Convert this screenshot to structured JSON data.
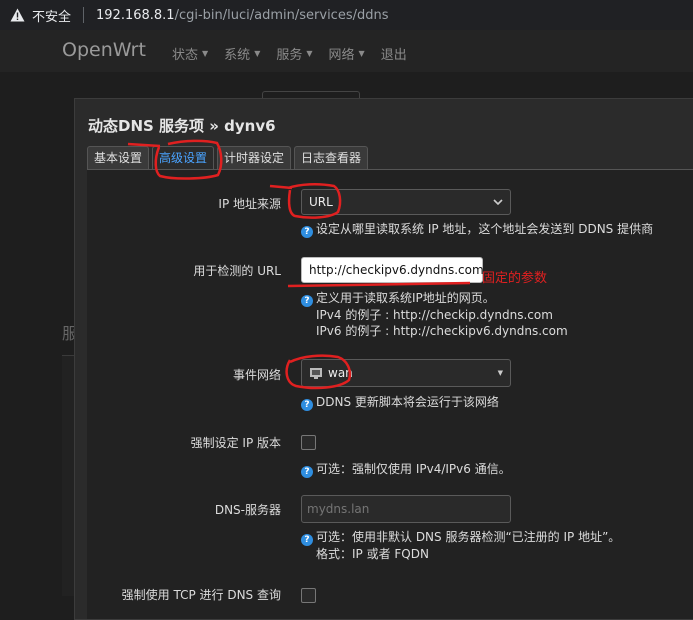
{
  "browser": {
    "insecure_label": "不安全",
    "url_host": "192.168.8.1",
    "url_path": "/cgi-bin/luci/admin/services/ddns"
  },
  "nav": {
    "brand": "OpenWrt",
    "items": [
      "状态",
      "系统",
      "服务",
      "网络",
      "退出"
    ]
  },
  "background": {
    "partial_heading": "服"
  },
  "modal": {
    "title": "动态DNS 服务项 » dynv6",
    "tabs": [
      "基本设置",
      "高级设置",
      "计时器设定",
      "日志查看器"
    ],
    "active_tab": "高级设置",
    "fields": {
      "ip_source": {
        "label": "IP 地址来源",
        "value": "URL",
        "help": "设定从哪里读取系统 IP 地址，这个地址会发送到 DDNS 提供商"
      },
      "check_url": {
        "label": "用于检测的 URL",
        "value": "http://checkipv6.dyndns.com",
        "help": "定义用于读取系统IP地址的网页。",
        "help_line2": "IPv4 的例子 : http://checkip.dyndns.com",
        "help_line3": "IPv6 的例子 : http://checkipv6.dyndns.com"
      },
      "event_network": {
        "label": "事件网络",
        "value": "wan",
        "help": "DDNS 更新脚本将会运行于该网络"
      },
      "force_ip_version": {
        "label": "强制设定 IP 版本",
        "help": "可选：强制仅使用 IPv4/IPv6 通信。"
      },
      "dns_server": {
        "label": "DNS-服务器",
        "placeholder": "mydns.lan",
        "help": "可选：使用非默认 DNS 服务器检测“已注册的 IP 地址”。",
        "help_line2": "格式：IP 或者 FQDN"
      },
      "force_tcp": {
        "label": "强制使用 TCP 进行 DNS 查询"
      }
    }
  },
  "annotation": {
    "text": "固定的参数",
    "color": "#e02020"
  },
  "colors": {
    "accent": "#4aa3ff",
    "help": "#2f8ee0",
    "markup": "#e02020"
  }
}
